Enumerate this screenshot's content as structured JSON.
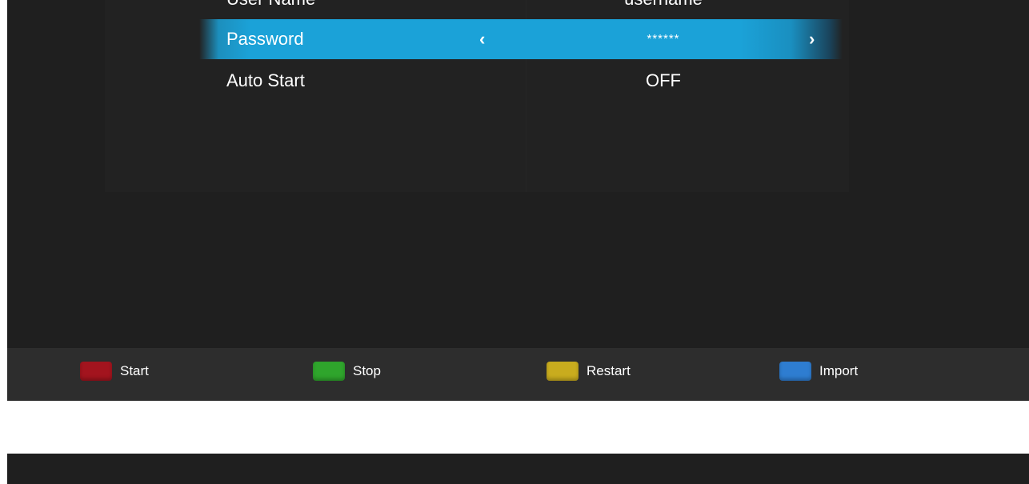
{
  "settings": {
    "rows": [
      {
        "label": "User Name",
        "value": "username"
      },
      {
        "label": "Password",
        "value": "******"
      },
      {
        "label": "Auto Start",
        "value": "OFF"
      }
    ],
    "arrow_left": "‹",
    "arrow_right": "›",
    "selected_index": 1
  },
  "footer": {
    "keys": [
      {
        "label": "Start",
        "color": "#a3141e",
        "icon": "red-key-icon"
      },
      {
        "label": "Stop",
        "color": "#2fa52c",
        "icon": "green-key-icon"
      },
      {
        "label": "Restart",
        "color": "#c9ac1e",
        "icon": "yellow-key-icon"
      },
      {
        "label": "Import",
        "color": "#2e7dd1",
        "icon": "blue-key-icon"
      }
    ]
  },
  "colors": {
    "highlight": "#1ba2d8",
    "background": "#1f1f1f",
    "footer": "#2d2d2d"
  }
}
